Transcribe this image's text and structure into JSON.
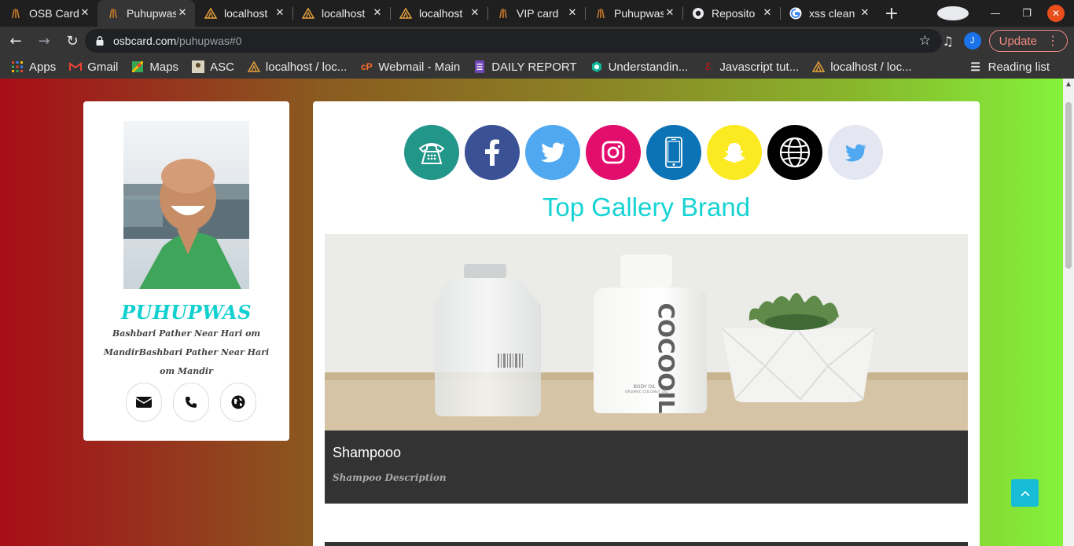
{
  "browser": {
    "tabs": [
      {
        "title": "OSB Card",
        "icon": "osb-favicon-icon",
        "active": false
      },
      {
        "title": "Puhupwas",
        "icon": "osb-favicon-icon",
        "active": true
      },
      {
        "title": "localhost",
        "icon": "phpmyadmin-icon",
        "active": false
      },
      {
        "title": "localhost",
        "icon": "phpmyadmin-icon",
        "active": false
      },
      {
        "title": "localhost",
        "icon": "phpmyadmin-icon",
        "active": false
      },
      {
        "title": "VIP card",
        "icon": "osb-favicon-icon",
        "active": false
      },
      {
        "title": "Puhupwas",
        "icon": "osb-favicon-icon",
        "active": false
      },
      {
        "title": "Reposito",
        "icon": "github-icon",
        "active": false
      },
      {
        "title": "xss clean",
        "icon": "google-icon",
        "active": false
      }
    ],
    "address": {
      "host": "osbcard.com",
      "path": "/puhupwas#0"
    },
    "profile_initial": "J",
    "update_label": "Update",
    "bookmarks": [
      {
        "label": "Apps",
        "icon": "apps-grid-icon"
      },
      {
        "label": "Gmail",
        "icon": "gmail-icon"
      },
      {
        "label": "Maps",
        "icon": "maps-icon"
      },
      {
        "label": "ASC",
        "icon": "asc-icon"
      },
      {
        "label": "localhost / loc...",
        "icon": "phpmyadmin-icon"
      },
      {
        "label": "Webmail - Main",
        "icon": "cpanel-icon"
      },
      {
        "label": "DAILY REPORT",
        "icon": "forms-icon"
      },
      {
        "label": "Understandin...",
        "icon": "hexagon-icon"
      },
      {
        "label": "Javascript tut...",
        "icon": "tutorial-icon"
      },
      {
        "label": "localhost / loc...",
        "icon": "phpmyadmin-icon"
      }
    ],
    "reading_list": "Reading list"
  },
  "profile": {
    "name": "PUHUPWAS",
    "address": "Bashbari Pather Near Hari om MandirBashbari Pather Near Hari om Mandir",
    "contacts": [
      "envelope-icon",
      "phone-icon",
      "globe-icon"
    ]
  },
  "socials": [
    {
      "name": "telephone-icon",
      "color": "#23968a"
    },
    {
      "name": "facebook-icon",
      "color": "#3a5195"
    },
    {
      "name": "twitter-icon",
      "color": "#4fa8f0"
    },
    {
      "name": "instagram-icon",
      "color": "#e20d6d"
    },
    {
      "name": "mobile-icon",
      "color": "#0b73b6"
    },
    {
      "name": "snapchat-icon",
      "color": "#fbea22"
    },
    {
      "name": "website-icon",
      "color": "#000000"
    },
    {
      "name": "twitter-icon",
      "color": "#e4e6f2"
    }
  ],
  "gallery": {
    "title": "Top Gallery Brand",
    "items": [
      {
        "name": "Shampooo",
        "description": "Shampoo Description",
        "bottle_label": "COCOOIL",
        "bottle_sublabel": "BODY OIL",
        "bottle_sub2": "ORGANIC COCONUT OIL"
      }
    ]
  },
  "colors": {
    "accent": "#17d3d3",
    "to_top": "#17bcd6"
  }
}
